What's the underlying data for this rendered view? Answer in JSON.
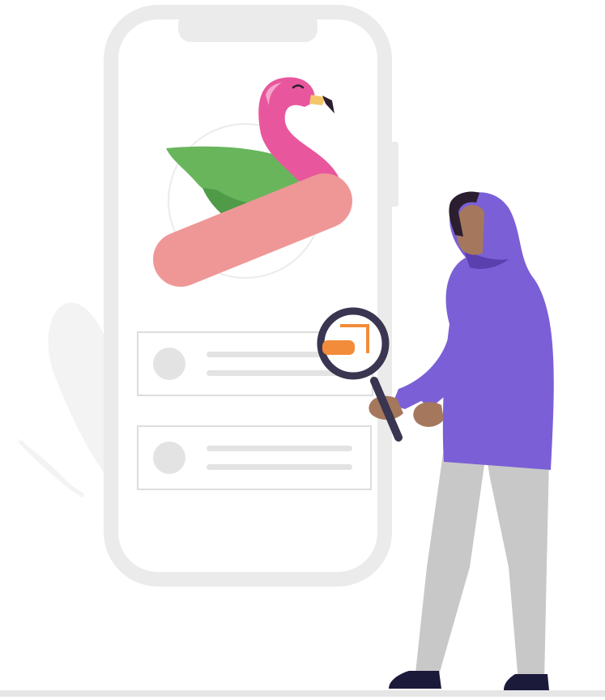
{
  "illustration": {
    "subject": "person-searching-phone",
    "colors": {
      "background": "#ffffff",
      "phone_frame": "#ebebeb",
      "card_border": "#dddddd",
      "placeholder_gray": "#e3e3e3",
      "decor_gray": "#f3f3f3",
      "flamingo_pink": "#e8579d",
      "flamingo_highlight": "#f6a6cc",
      "beak_yellow": "#f3c76a",
      "leaf_green": "#69b55c",
      "leaf_dark_green": "#4f9b47",
      "float_pink": "#ef9797",
      "hijab_purple": "#7b5fd6",
      "hijab_dark": "#5a3fae",
      "skin_brown": "#a5785d",
      "hair_dark": "#2b1e2f",
      "magnifier_navy": "#3a3550",
      "magnifier_orange": "#f28c3a",
      "pants_gray": "#c8c8c8",
      "shoe_navy": "#1c1a3b",
      "ground_gray": "#e6e6e6"
    },
    "phone": {
      "cards": [
        {
          "kind": "list-card-with-avatar-and-two-lines"
        },
        {
          "kind": "list-card-with-avatar-and-two-lines"
        }
      ]
    },
    "icons": [
      "flamingo-float-icon",
      "magnifying-glass-icon"
    ]
  }
}
